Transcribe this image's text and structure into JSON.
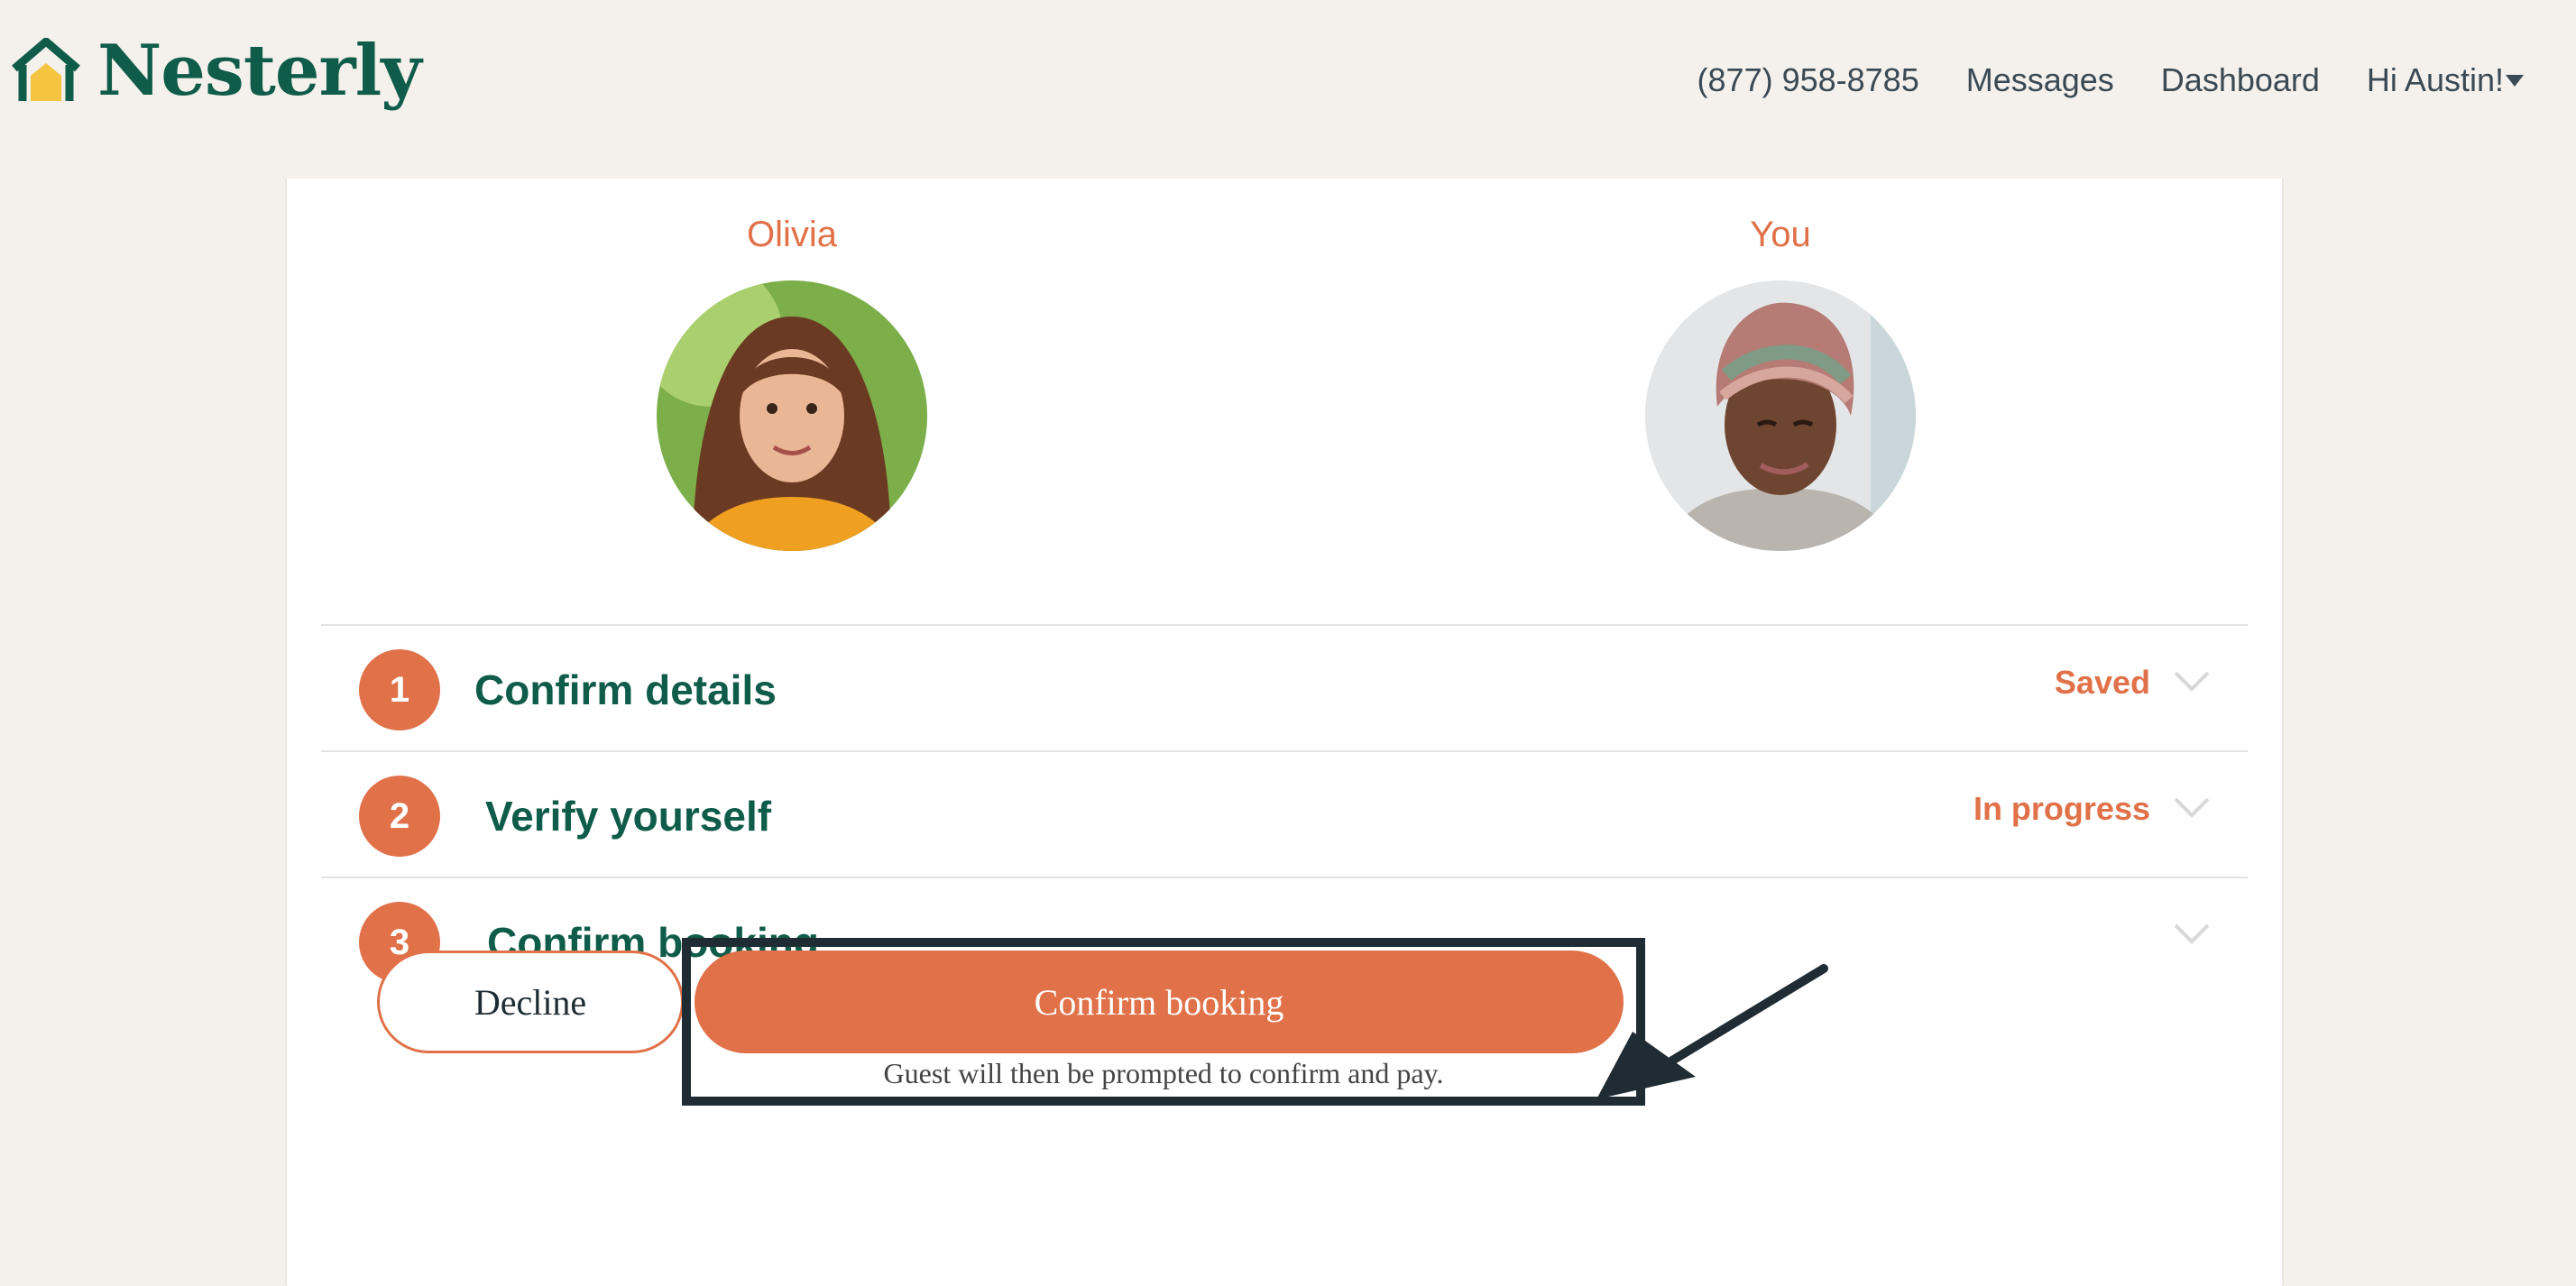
{
  "brand": {
    "name": "Nesterly",
    "color": "#0f5c4a",
    "accent": "#f5c542"
  },
  "nav": {
    "phone": "(877) 958-8785",
    "messages": "Messages",
    "dashboard": "Dashboard",
    "greeting": "Hi Austin!",
    "greeting_icon": "caret-down-icon"
  },
  "participants": [
    {
      "name": "Olivia",
      "avatar": "avatar-photo"
    },
    {
      "name": "You",
      "avatar": "avatar-photo"
    }
  ],
  "steps": [
    {
      "number": "1",
      "title": "Confirm details",
      "status": "Saved",
      "icon": "chevron-down-icon"
    },
    {
      "number": "2",
      "title": "Verify yourself",
      "status": "In progress",
      "icon": "chevron-down-icon"
    },
    {
      "number": "3",
      "title": "Confirm booking",
      "status": "",
      "icon": "chevron-down-icon"
    }
  ],
  "actions": {
    "decline": "Decline",
    "confirm": "Confirm booking",
    "note": "Guest will then be prompted to confirm and pay."
  },
  "colors": {
    "accent": "#e07148",
    "heading": "#0f5c4a",
    "annotation": "#1f2c33",
    "background": "#f4f0eb"
  }
}
